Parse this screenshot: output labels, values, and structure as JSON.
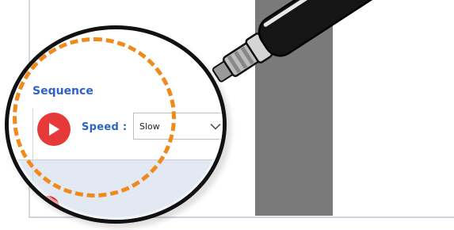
{
  "colors": {
    "accent": "#2d63c8",
    "play": "#e63a3a",
    "highlight": "#f08a1c",
    "panel_dark": "#7a7a7a"
  },
  "sequence": {
    "group_title": "Sequence",
    "play_icon": "play-icon",
    "speed_label": "Speed :",
    "speed_value": "Slow",
    "speed_chevron_icon": "chevron-down-icon"
  },
  "magnifier": {
    "icon": "magnifier-icon"
  }
}
